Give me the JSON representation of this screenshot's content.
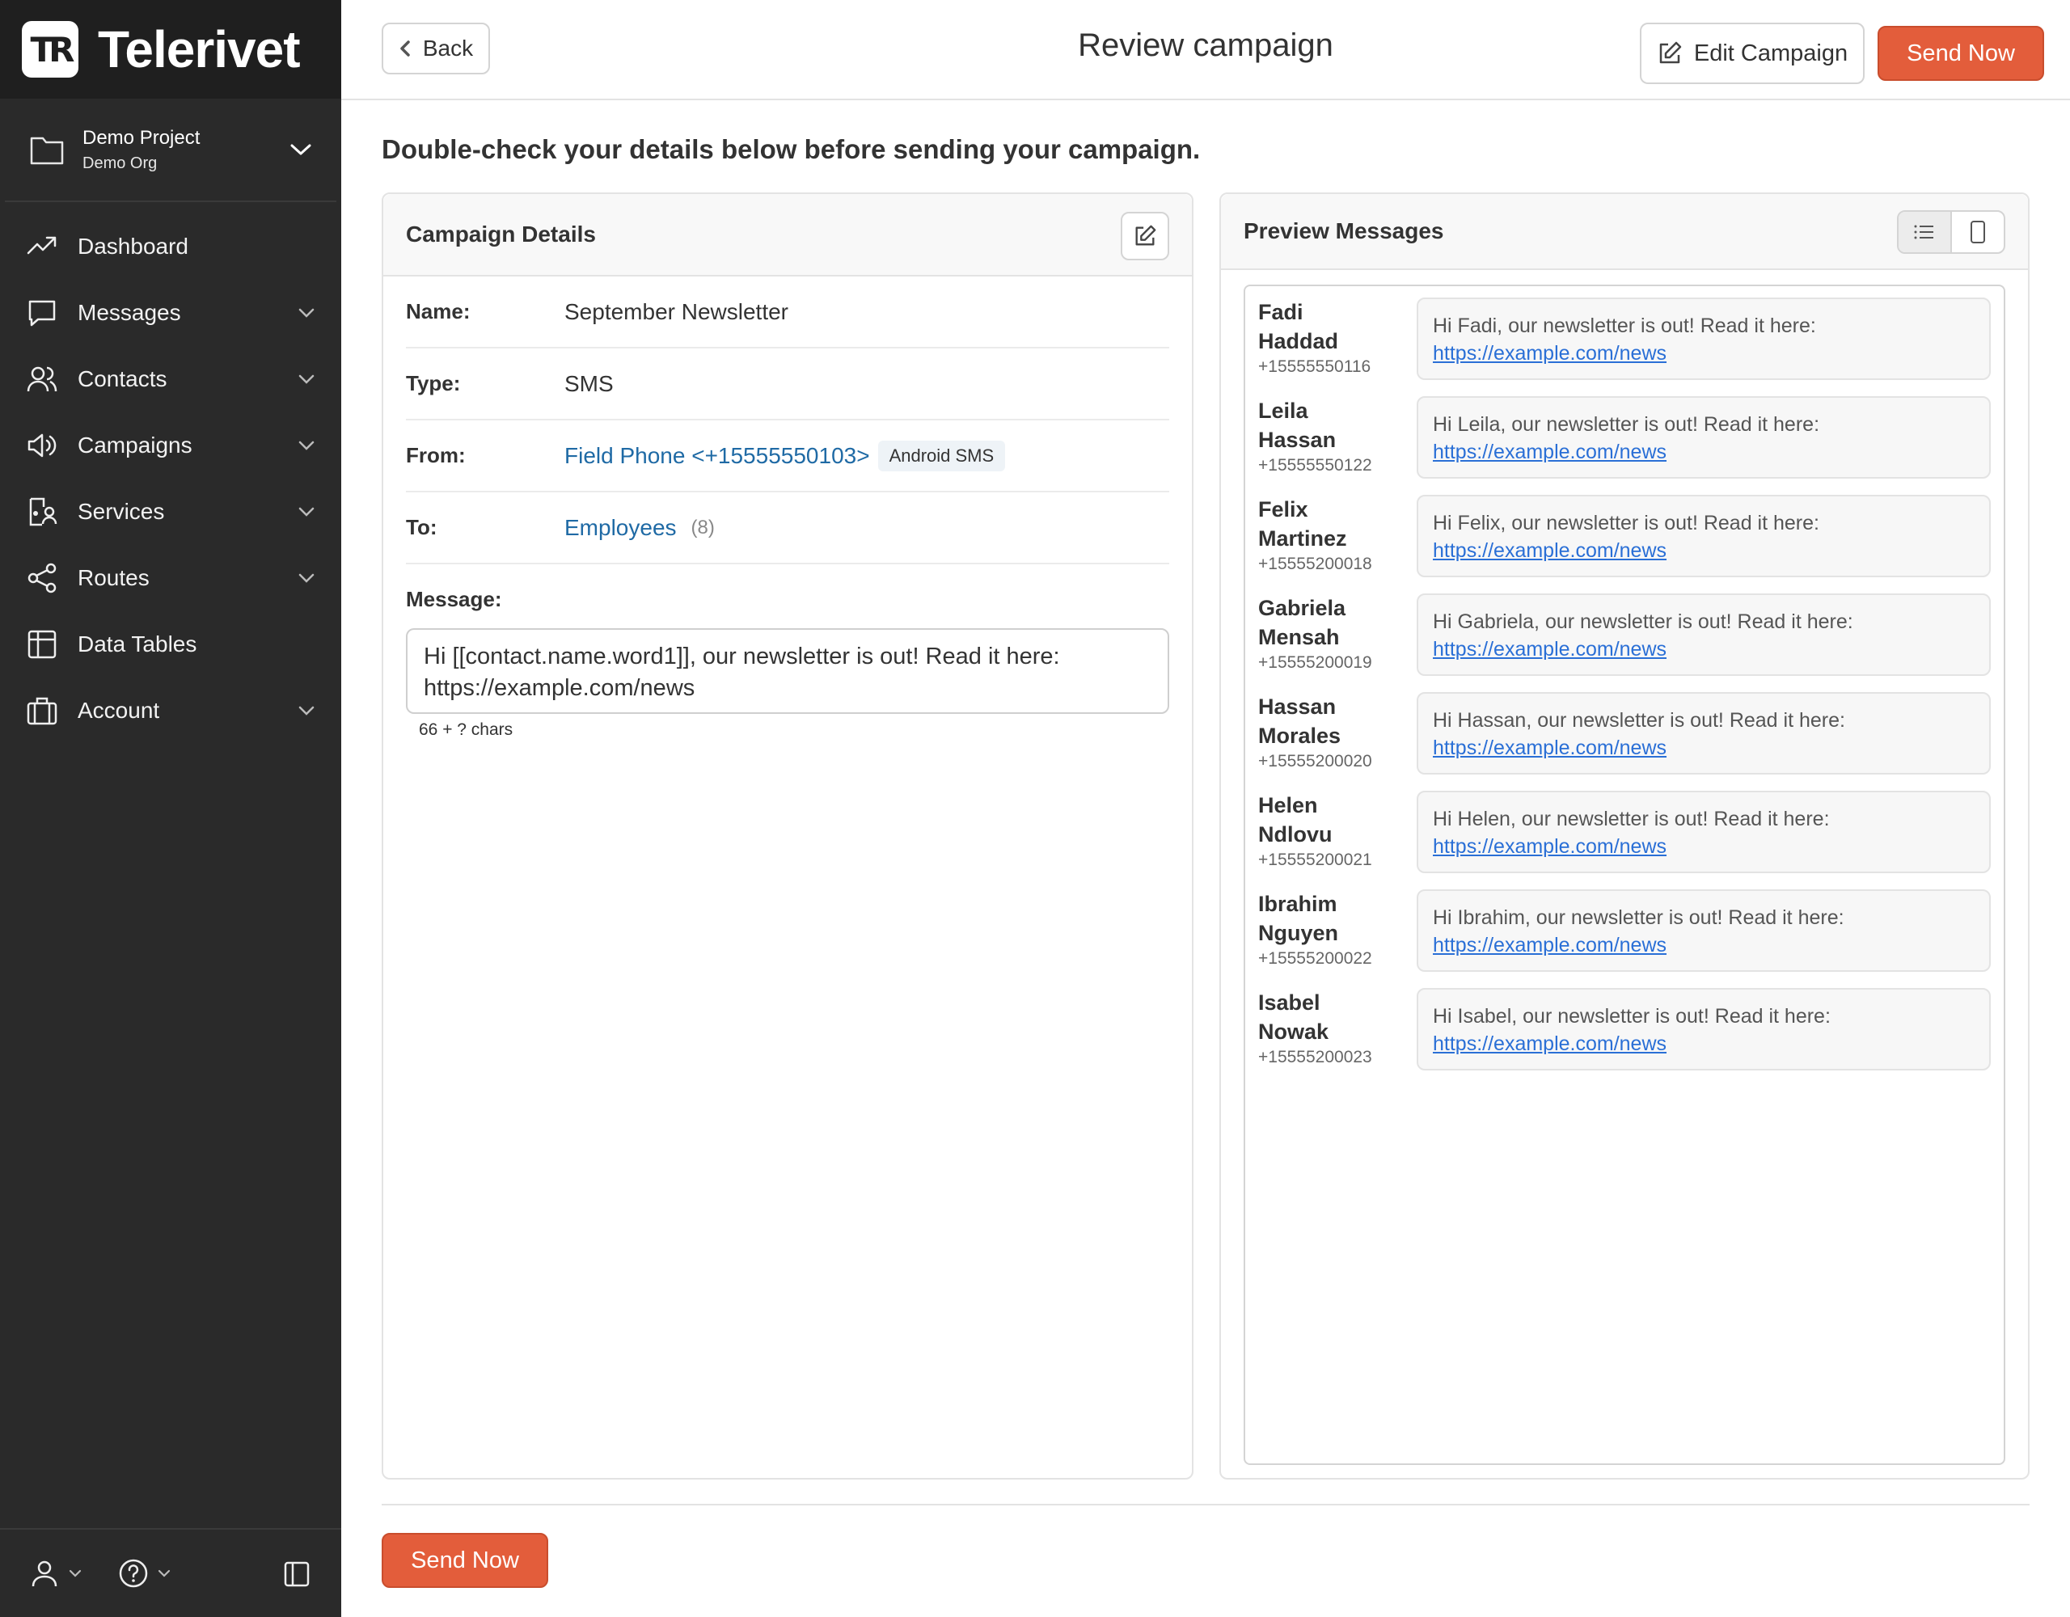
{
  "app": {
    "name": "Telerivet",
    "logo_mark": "TR"
  },
  "project": {
    "name": "Demo Project",
    "org": "Demo Org"
  },
  "sidebar": {
    "items": [
      {
        "label": "Dashboard",
        "icon": "trending-up-icon",
        "has_chevron": false
      },
      {
        "label": "Messages",
        "icon": "chat-bubble-icon",
        "has_chevron": true
      },
      {
        "label": "Contacts",
        "icon": "users-icon",
        "has_chevron": true
      },
      {
        "label": "Campaigns",
        "icon": "megaphone-icon",
        "has_chevron": true
      },
      {
        "label": "Services",
        "icon": "services-icon",
        "has_chevron": true
      },
      {
        "label": "Routes",
        "icon": "share-icon",
        "has_chevron": true
      },
      {
        "label": "Data Tables",
        "icon": "table-icon",
        "has_chevron": false
      },
      {
        "label": "Account",
        "icon": "briefcase-icon",
        "has_chevron": true
      }
    ]
  },
  "header": {
    "back_label": "Back",
    "title": "Review campaign",
    "edit_label": "Edit Campaign",
    "send_label": "Send Now"
  },
  "intro": "Double-check your details below before sending your campaign.",
  "details": {
    "title": "Campaign Details",
    "name_label": "Name:",
    "name_value": "September Newsletter",
    "type_label": "Type:",
    "type_value": "SMS",
    "from_label": "From:",
    "from_value": "Field Phone <+15555550103>",
    "from_badge": "Android SMS",
    "to_label": "To:",
    "to_value": "Employees",
    "to_count": "(8)",
    "message_label": "Message:",
    "message_value": "Hi [[contact.name.word1]], our newsletter is out! Read it here: https://example.com/news",
    "chars": "66 + ? chars"
  },
  "preview": {
    "title": "Preview Messages",
    "messages": [
      {
        "first": "Fadi",
        "last": "Haddad",
        "phone": "+15555550116",
        "text": "Hi Fadi, our newsletter is out! Read it here:",
        "link": "https://example.com/news"
      },
      {
        "first": "Leila",
        "last": "Hassan",
        "phone": "+15555550122",
        "text": "Hi Leila, our newsletter is out! Read it here:",
        "link": "https://example.com/news"
      },
      {
        "first": "Felix",
        "last": "Martinez",
        "phone": "+15555200018",
        "text": "Hi Felix, our newsletter is out! Read it here:",
        "link": "https://example.com/news"
      },
      {
        "first": "Gabriela",
        "last": "Mensah",
        "phone": "+15555200019",
        "text": "Hi Gabriela, our newsletter is out! Read it here:",
        "link": "https://example.com/news"
      },
      {
        "first": "Hassan",
        "last": "Morales",
        "phone": "+15555200020",
        "text": "Hi Hassan, our newsletter is out! Read it here:",
        "link": "https://example.com/news"
      },
      {
        "first": "Helen",
        "last": "Ndlovu",
        "phone": "+15555200021",
        "text": "Hi Helen, our newsletter is out! Read it here:",
        "link": "https://example.com/news"
      },
      {
        "first": "Ibrahim",
        "last": "Nguyen",
        "phone": "+15555200022",
        "text": "Hi Ibrahim, our newsletter is out! Read it here:",
        "link": "https://example.com/news"
      },
      {
        "first": "Isabel",
        "last": "Nowak",
        "phone": "+15555200023",
        "text": "Hi Isabel, our newsletter is out! Read it here:",
        "link": "https://example.com/news"
      }
    ]
  },
  "footer": {
    "send_label": "Send Now"
  },
  "colors": {
    "accent": "#e35d3b",
    "sidebar_bg": "#2a2a2a",
    "link": "#1f6aa5"
  }
}
